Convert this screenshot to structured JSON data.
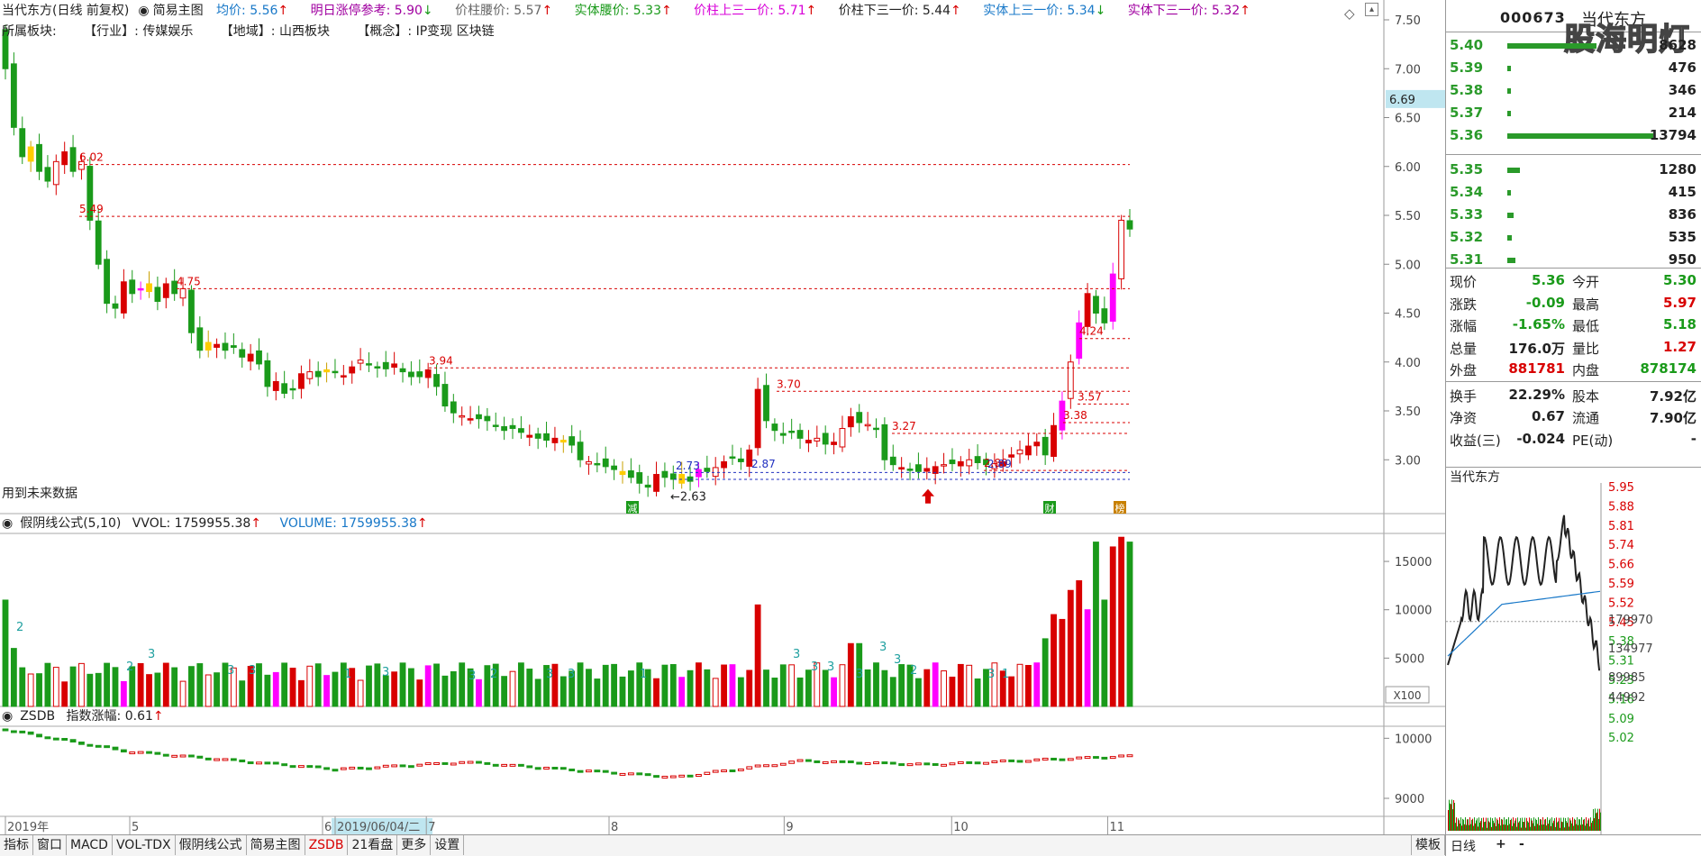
{
  "header": {
    "stock_label": "当代东方(日线 前复权)",
    "mode_label": "简易主图",
    "avg_label": "均价: 5.56",
    "limit_label": "明日涨停参考: 5.90",
    "pillar_waist": "价柱腰价: 5.57",
    "body_waist": "实体腰价: 5.33",
    "pillar_up": "价柱上三一价: 5.71",
    "pillar_down": "价柱下三一价: 5.44",
    "body_up": "实体上三一价: 5.34",
    "body_down": "实体下三一价: 5.32",
    "sector_title": "所属板块:",
    "industry": "【行业】: 传媒娱乐",
    "region": "【地域】: 山西板块",
    "concept": "【概念】: IP变现 区块链"
  },
  "notice": "用到未来数据",
  "vol_header": {
    "name": "假阴线公式(5,10)",
    "vvol": "VVOL: 1759955.38",
    "volume": "VOLUME: 1759955.38"
  },
  "index_header": {
    "name": "ZSDB",
    "label": "指数涨幅: 0.61"
  },
  "price_axis": [
    "7.50",
    "7.00",
    "6.50",
    "6.00",
    "5.50",
    "5.00",
    "4.50",
    "4.00",
    "3.50",
    "3.00"
  ],
  "current_price_tag": "6.69",
  "vol_axis": [
    "15000",
    "10000",
    "5000"
  ],
  "vol_unit": "X100",
  "idx_axis": [
    "10000",
    "9000"
  ],
  "x_axis": [
    "2019年",
    "5",
    "6",
    "2019/06/04/二",
    "7",
    "8",
    "9",
    "10",
    "11"
  ],
  "levels": [
    "6.02",
    "5.49",
    "4.75",
    "3.94",
    "3.70",
    "3.27",
    "2.89",
    "2.87",
    "2.73",
    "4.24",
    "3.57",
    "3.38"
  ],
  "low_label": "2.63",
  "markers": [
    "减",
    "财",
    "榜"
  ],
  "vol_small_labels": [
    "2",
    "2",
    "3",
    "3",
    "3",
    "1",
    "3",
    "3",
    "2",
    "3",
    "3",
    "1",
    "3",
    "3",
    "3",
    "3",
    "3",
    "3",
    "2",
    "3",
    "1"
  ],
  "right_panel": {
    "code": "000673",
    "name": "当代东方",
    "watermark": "股海明灯",
    "order_book": [
      {
        "price": "5.40",
        "vol": "8628",
        "bar": 0.55
      },
      {
        "price": "5.39",
        "vol": "476",
        "bar": 0.02
      },
      {
        "price": "5.38",
        "vol": "346",
        "bar": 0.02
      },
      {
        "price": "5.37",
        "vol": "214",
        "bar": 0.02
      },
      {
        "price": "5.36",
        "vol": "13794",
        "bar": 0.9
      },
      {
        "price": "5.35",
        "vol": "1280",
        "bar": 0.08
      },
      {
        "price": "5.34",
        "vol": "415",
        "bar": 0.02
      },
      {
        "price": "5.33",
        "vol": "836",
        "bar": 0.04
      },
      {
        "price": "5.32",
        "vol": "535",
        "bar": 0.03
      },
      {
        "price": "5.31",
        "vol": "950",
        "bar": 0.05
      }
    ],
    "stats": [
      {
        "l": "现价",
        "lv": "5.36",
        "r": "今开",
        "rv": "5.30",
        "lc": "dn",
        "rc": "dn"
      },
      {
        "l": "涨跌",
        "lv": "-0.09",
        "r": "最高",
        "rv": "5.97",
        "lc": "dn",
        "rc": "up"
      },
      {
        "l": "涨幅",
        "lv": "-1.65%",
        "r": "最低",
        "rv": "5.18",
        "lc": "dn",
        "rc": "dn"
      },
      {
        "l": "总量",
        "lv": "176.0万",
        "r": "量比",
        "rv": "1.27",
        "lc": "blk",
        "rc": "up"
      },
      {
        "l": "外盘",
        "lv": "881781",
        "r": "内盘",
        "rv": "878174",
        "lc": "up",
        "rc": "dn"
      },
      {
        "l": "换手",
        "lv": "22.29%",
        "r": "股本",
        "rv": "7.92亿",
        "lc": "blk",
        "rc": "blk"
      },
      {
        "l": "净资",
        "lv": "0.67",
        "r": "流通",
        "rv": "7.90亿",
        "lc": "blk",
        "rc": "blk"
      },
      {
        "l": "收益(三)",
        "lv": "-0.024",
        "r": "PE(动)",
        "rv": "-",
        "lc": "blk",
        "rc": "blk"
      }
    ],
    "mini_title": "当代东方",
    "mini_price_axis": [
      "5.95",
      "5.88",
      "5.81",
      "5.74",
      "5.66",
      "5.59",
      "5.52",
      "5.45",
      "5.38",
      "5.31",
      "5.23",
      "5.16",
      "5.09",
      "5.02"
    ],
    "mini_vol_axis": [
      "179970",
      "134977",
      "89985",
      "44992"
    ],
    "bottom": {
      "period": "日线",
      "add": "+",
      "minus": "-"
    }
  },
  "bottom_tabs": [
    "指标",
    "窗口",
    "MACD",
    "VOL-TDX",
    "假阴线公式",
    "简易主图",
    "ZSDB",
    "21看盘",
    "更多",
    "设置"
  ],
  "bottom_right_tab": "模板",
  "colors": {
    "up": "#d80000",
    "down": "#1a9a1a",
    "bg": "#ffffff",
    "blue": "#1878c8",
    "magenta": "#ff00ff",
    "yellow": "#ffcc00"
  }
}
